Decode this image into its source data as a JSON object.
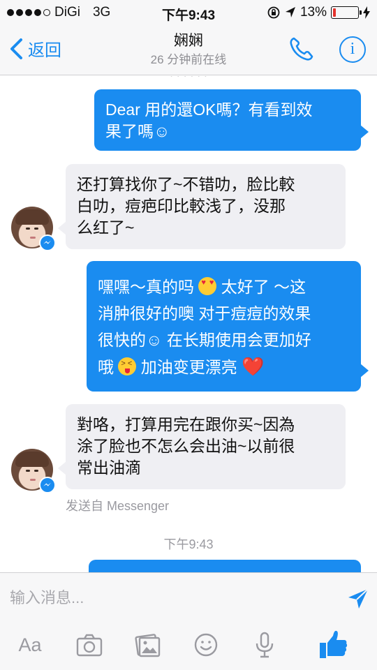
{
  "status_bar": {
    "carrier": "DiGi",
    "network": "3G",
    "time": "下午9:43",
    "battery_percent": "13%",
    "battery_level": 0.13
  },
  "header": {
    "back_label": "返回",
    "contact_name": "娴娴",
    "presence": "26 分钟前在线"
  },
  "messages": [
    {
      "direction": "out",
      "parts": [
        "Dear 用的還OK嗎？有看到效",
        "果了嗎☺"
      ]
    },
    {
      "direction": "in",
      "parts": [
        "还打算找你了~不错叻，脸比較",
        "白叻，痘疤印比較浅了，没那",
        "么红了~"
      ]
    },
    {
      "direction": "out",
      "parts": [
        "嘿嘿～真的吗",
        "太好了 ～这",
        "消肿很好的噢 对于痘痘的效果",
        "很快的☺ 在长期使用会更加好",
        "哦",
        "加油变更漂亮",
        "❤️"
      ]
    },
    {
      "direction": "in",
      "parts": [
        "對咯，打算用完在跟你买~因為",
        "涂了脸也不怎么会出油~以前很",
        "常出油滴"
      ]
    }
  ],
  "sent_from": "发送自 Messenger",
  "timestamp": "下午9:43",
  "composer": {
    "placeholder": "输入消息...",
    "aa_label": "Aa"
  },
  "colors": {
    "accent": "#1a8cf0",
    "incoming_bubble": "#efeff3",
    "battery_low": "#e4332d"
  },
  "icons": [
    "back-chevron-icon",
    "phone-icon",
    "info-icon",
    "messenger-badge-icon",
    "send-icon",
    "camera-icon",
    "photo-gallery-icon",
    "sticker-smiley-icon",
    "microphone-icon",
    "thumbs-up-icon"
  ]
}
